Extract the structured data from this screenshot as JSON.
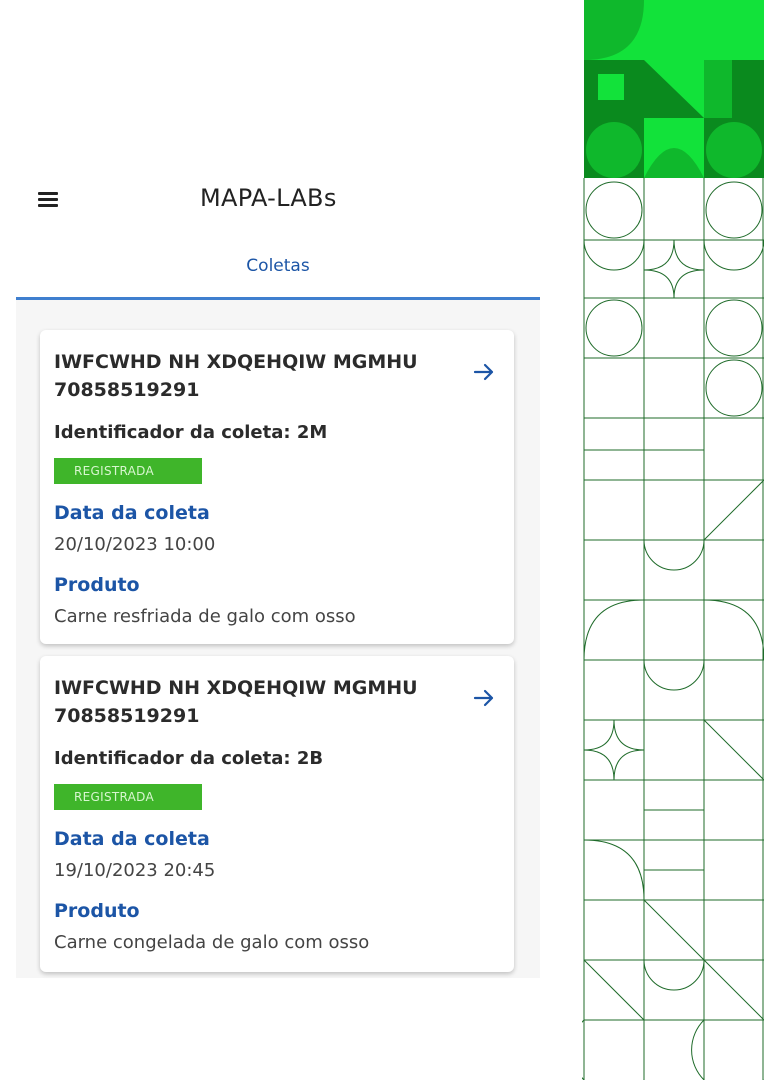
{
  "header": {
    "title": "MAPA-LABs",
    "menu_icon": "hamburger-menu-icon"
  },
  "tabs": [
    {
      "label": "Coletas",
      "active": true
    }
  ],
  "colors": {
    "accent": "#1c55a6",
    "badge_green": "#3fb52a",
    "deco_green": "#0a8a1e"
  },
  "coletas": [
    {
      "title": "IWFCWHD NH XDQEHQIW MGMHU 70858519291",
      "identifier": "Identificador da coleta: 2M",
      "status": "REGISTRADA",
      "date_label": "Data da coleta",
      "date_value": "20/10/2023 10:00",
      "product_label": "Produto",
      "product_value": "Carne resfriada de galo com osso"
    },
    {
      "title": "IWFCWHD NH XDQEHQIW MGMHU 70858519291",
      "identifier": "Identificador da coleta: 2B",
      "status": "REGISTRADA",
      "date_label": "Data da coleta",
      "date_value": "19/10/2023 20:45",
      "product_label": "Produto",
      "product_value": "Carne congelada de galo com osso"
    }
  ]
}
